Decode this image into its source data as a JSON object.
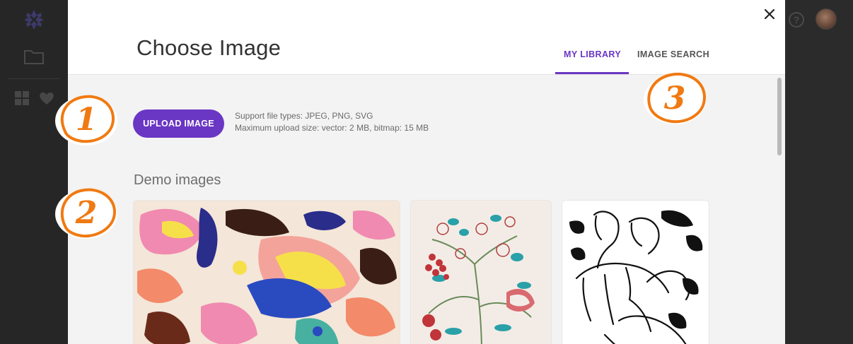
{
  "modal": {
    "title": "Choose Image",
    "tabs": [
      {
        "label": "MY LIBRARY",
        "active": true
      },
      {
        "label": "IMAGE SEARCH",
        "active": false
      }
    ],
    "upload": {
      "button_label": "UPLOAD IMAGE",
      "info_line1": "Support file types: JPEG, PNG, SVG",
      "info_line2": "Maximum upload size: vector: 2 MB, bitmap: 15 MB"
    },
    "demo_section": {
      "title": "Demo images",
      "images": [
        {
          "name": "colorful-folk-pattern"
        },
        {
          "name": "floral-botanical-illustration"
        },
        {
          "name": "horses-line-drawing"
        }
      ]
    }
  },
  "annotations": [
    {
      "number": "1"
    },
    {
      "number": "2"
    },
    {
      "number": "3"
    }
  ],
  "background_app": {
    "icons": [
      "logo-icon",
      "folder-icon",
      "grid-icon",
      "heart-icon",
      "help-icon",
      "avatar"
    ]
  },
  "colors": {
    "accent": "#6a36c4",
    "annotation": "#f07a12",
    "modal_bg": "#f3f3f3",
    "header_bg": "#ffffff"
  }
}
